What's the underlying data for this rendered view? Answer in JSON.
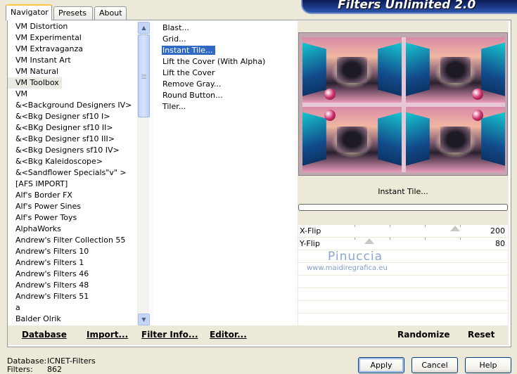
{
  "banner": {
    "title": "Filters Unlimited 2.0"
  },
  "tabs": [
    {
      "label": "Navigator",
      "active": true
    },
    {
      "label": "Presets",
      "active": false
    },
    {
      "label": "About",
      "active": false
    }
  ],
  "categories": [
    "VM Distortion",
    "VM Experimental",
    "VM Extravaganza",
    "VM Instant Art",
    "VM Natural",
    "VM Toolbox",
    "VM",
    "&<Background Designers IV>",
    "&<Bkg Designer sf10 I>",
    "&<BKg Designer sf10 II>",
    "&<Bkg Designer sf10 III>",
    "&<Bkg Designers sf10 IV>",
    "&<Bkg Kaleidoscope>",
    "&<Sandflower Specials\"v\" >",
    "[AFS IMPORT]",
    "Alf's Border FX",
    "Alf's Power Sines",
    "Alf's Power Toys",
    "AlphaWorks",
    "Andrew's Filter Collection 55",
    "Andrew's Filters 10",
    "Andrew's Filters 1",
    "Andrew's Filters 46",
    "Andrew's Filters 48",
    "Andrew's Filters 51",
    "a",
    "Balder Olrik"
  ],
  "selected_category": "VM Toolbox",
  "filters": [
    "Blast...",
    "Grid...",
    "Instant Tile...",
    "Lift the Cover (With Alpha)",
    "Lift the Cover",
    "Remove Gray...",
    "Round Button...",
    "Tiler..."
  ],
  "selected_filter": "Instant Tile...",
  "preview": {
    "filter_name": "Instant Tile..."
  },
  "params": [
    {
      "name": "X-Flip",
      "value": "200",
      "level": 0.78
    },
    {
      "name": "Y-Flip",
      "value": "80",
      "level": 0.31
    }
  ],
  "watermark": {
    "name": "Pinuccia",
    "url": "www.maidiregrafica.eu"
  },
  "toolbar": {
    "database": "Database",
    "import": "Import...",
    "filter_info": "Filter Info...",
    "editor": "Editor...",
    "randomize": "Randomize",
    "reset": "Reset"
  },
  "status": {
    "database_label": "Database:",
    "database_value": "ICNET-Filters",
    "filters_label": "Filters:",
    "filters_value": "862"
  },
  "buttons": {
    "apply": "Apply",
    "cancel": "Cancel",
    "help": "Help"
  },
  "colors": {
    "selection": "#316AC5",
    "banner": "#1F3C8E",
    "tab_highlight": "#FFC83C"
  }
}
